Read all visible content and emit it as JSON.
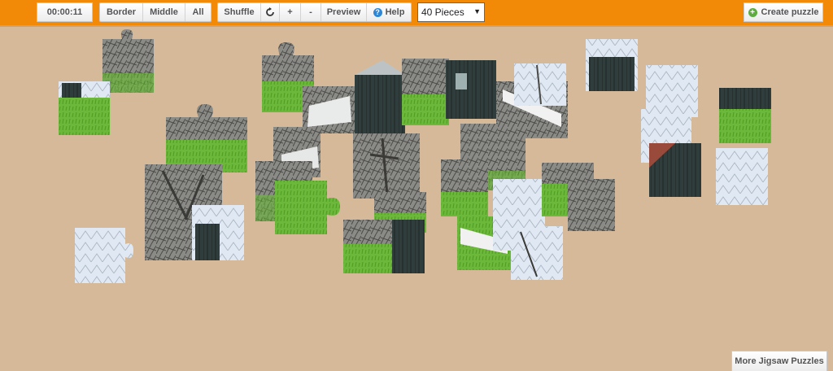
{
  "toolbar": {
    "timer": "00:00:11",
    "filters": [
      "Border",
      "Middle",
      "All"
    ],
    "shuffle_label": "Shuffle",
    "rotate_icon": "rotate-icon",
    "zoom_in_label": "+",
    "zoom_out_label": "-",
    "preview_label": "Preview",
    "help_label": "Help",
    "help_icon": "?",
    "pieces_selected": "40 Pieces",
    "create_label": "Create puzzle",
    "create_icon": "+"
  },
  "footer": {
    "more_label": "More Jigsaw Puzzles"
  },
  "colors": {
    "toolbar_bg": "#f28a08",
    "board_bg": "#d5b999",
    "grass": "#6dbb3c",
    "sky": "#dde8f4",
    "tree": "#5c5a55",
    "house": "#2d3a3a"
  }
}
